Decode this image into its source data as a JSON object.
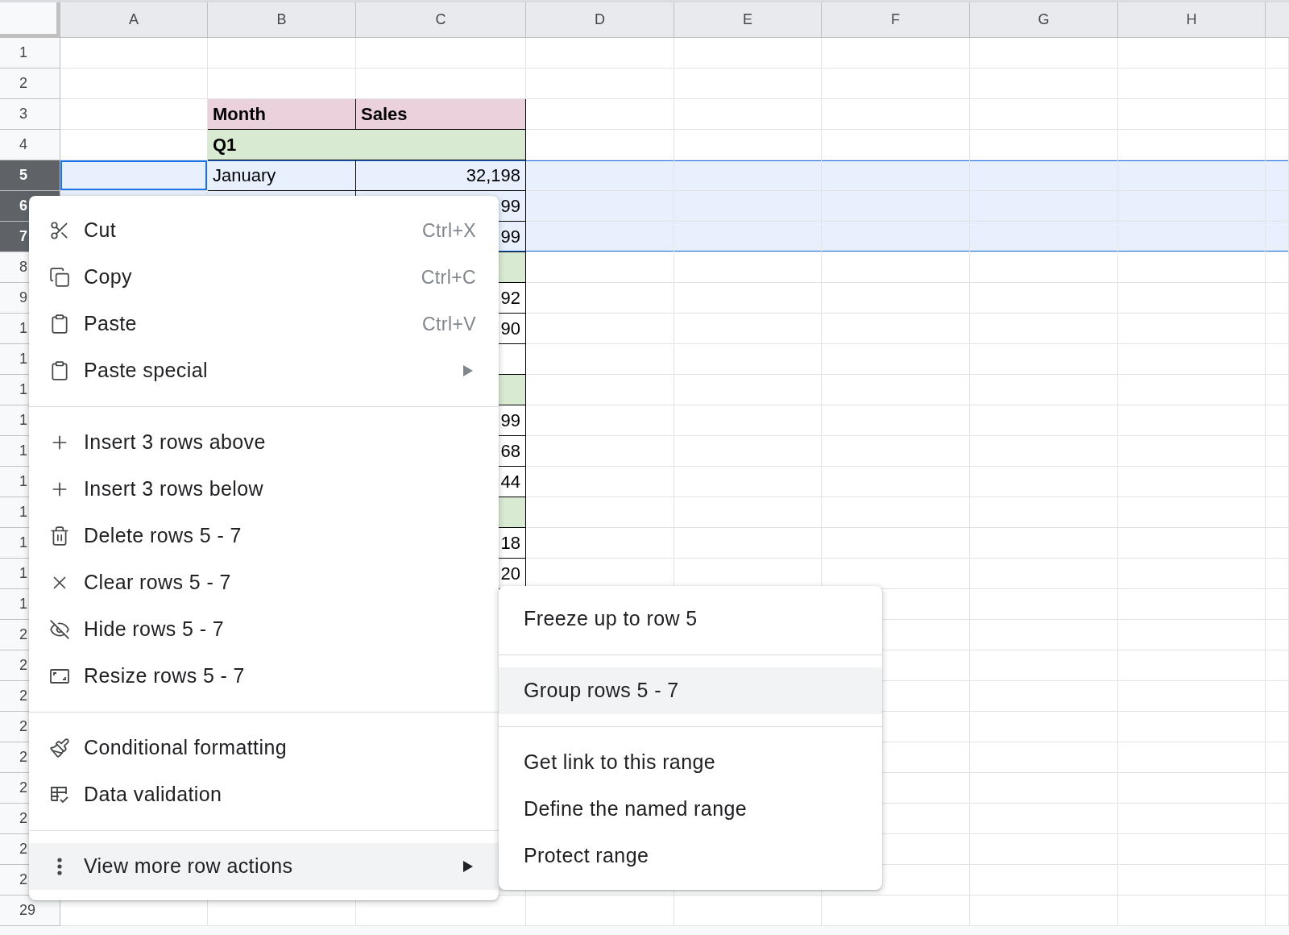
{
  "columns": [
    {
      "label": "A"
    },
    {
      "label": "B"
    },
    {
      "label": "C"
    },
    {
      "label": "D"
    },
    {
      "label": "E"
    },
    {
      "label": "F"
    },
    {
      "label": "G"
    },
    {
      "label": "H"
    }
  ],
  "rows": [
    {
      "label": "1",
      "selected": false
    },
    {
      "label": "2",
      "selected": false
    },
    {
      "label": "3",
      "selected": false,
      "kind": "header",
      "month": "Month",
      "sales": "Sales"
    },
    {
      "label": "4",
      "selected": false,
      "kind": "quarter",
      "month": "Q1"
    },
    {
      "label": "5",
      "selected": true,
      "active": true,
      "kind": "data",
      "month": "January",
      "sales": "32,198"
    },
    {
      "label": "6",
      "selected": true,
      "kind": "data",
      "sales": "99"
    },
    {
      "label": "7",
      "selected": true,
      "kind": "data",
      "sales": "99"
    },
    {
      "label": "8",
      "selected": false,
      "kind": "quarter"
    },
    {
      "label": "9",
      "selected": false,
      "kind": "data",
      "sales": "92"
    },
    {
      "label": "1",
      "selected": false,
      "kind": "data",
      "sales": "90"
    },
    {
      "label": "1",
      "selected": false,
      "kind": "data"
    },
    {
      "label": "1",
      "selected": false,
      "kind": "quarter"
    },
    {
      "label": "1",
      "selected": false,
      "kind": "data",
      "sales": "99"
    },
    {
      "label": "1",
      "selected": false,
      "kind": "data",
      "sales": "68"
    },
    {
      "label": "1",
      "selected": false,
      "kind": "data",
      "sales": "44"
    },
    {
      "label": "1",
      "selected": false,
      "kind": "quarter"
    },
    {
      "label": "1",
      "selected": false,
      "kind": "data",
      "sales": "18"
    },
    {
      "label": "1",
      "selected": false,
      "kind": "data",
      "sales": "20"
    },
    {
      "label": "1",
      "selected": false
    },
    {
      "label": "2",
      "selected": false
    },
    {
      "label": "2",
      "selected": false
    },
    {
      "label": "2",
      "selected": false
    },
    {
      "label": "2",
      "selected": false
    },
    {
      "label": "2",
      "selected": false
    },
    {
      "label": "2",
      "selected": false
    },
    {
      "label": "2",
      "selected": false
    },
    {
      "label": "2",
      "selected": false
    },
    {
      "label": "2",
      "selected": false
    },
    {
      "label": "29",
      "selected": false
    }
  ],
  "context_menu": {
    "sections": [
      [
        {
          "kind": "cut",
          "label": "Cut",
          "shortcut": "Ctrl+X",
          "submenu": false,
          "selected": false
        },
        {
          "kind": "copy",
          "label": "Copy",
          "shortcut": "Ctrl+C",
          "submenu": false,
          "selected": false
        },
        {
          "kind": "paste",
          "label": "Paste",
          "shortcut": "Ctrl+V",
          "submenu": false,
          "selected": false
        },
        {
          "kind": "paste",
          "label": "Paste special",
          "submenu": true,
          "selected": false
        }
      ],
      [
        {
          "kind": "insert",
          "label": "Insert 3 rows above",
          "submenu": false,
          "selected": false
        },
        {
          "kind": "insert",
          "label": "Insert 3 rows below",
          "submenu": false,
          "selected": false
        },
        {
          "kind": "delete",
          "label": "Delete rows 5 - 7",
          "submenu": false,
          "selected": false
        },
        {
          "kind": "clear",
          "label": "Clear rows 5 - 7",
          "submenu": false,
          "selected": false
        },
        {
          "kind": "hide",
          "label": "Hide rows 5 - 7",
          "submenu": false,
          "selected": false
        },
        {
          "kind": "resize",
          "label": "Resize rows 5 - 7",
          "submenu": false,
          "selected": false
        }
      ],
      [
        {
          "kind": "format",
          "label": "Conditional formatting",
          "submenu": false,
          "selected": false
        },
        {
          "kind": "validation",
          "label": "Data validation",
          "submenu": false,
          "selected": false
        }
      ],
      [
        {
          "kind": "more",
          "label": "View more row actions",
          "submenu": true,
          "selected": true
        }
      ]
    ]
  },
  "submenu": {
    "sections": [
      [
        {
          "label": "Freeze up to row 5",
          "selected": false
        }
      ],
      [
        {
          "label": "Group rows 5 - 7",
          "selected": true
        }
      ],
      [
        {
          "label": "Get link to this range",
          "selected": false
        },
        {
          "label": "Define the named range",
          "selected": false
        },
        {
          "label": "Protect range",
          "selected": false
        }
      ]
    ]
  }
}
